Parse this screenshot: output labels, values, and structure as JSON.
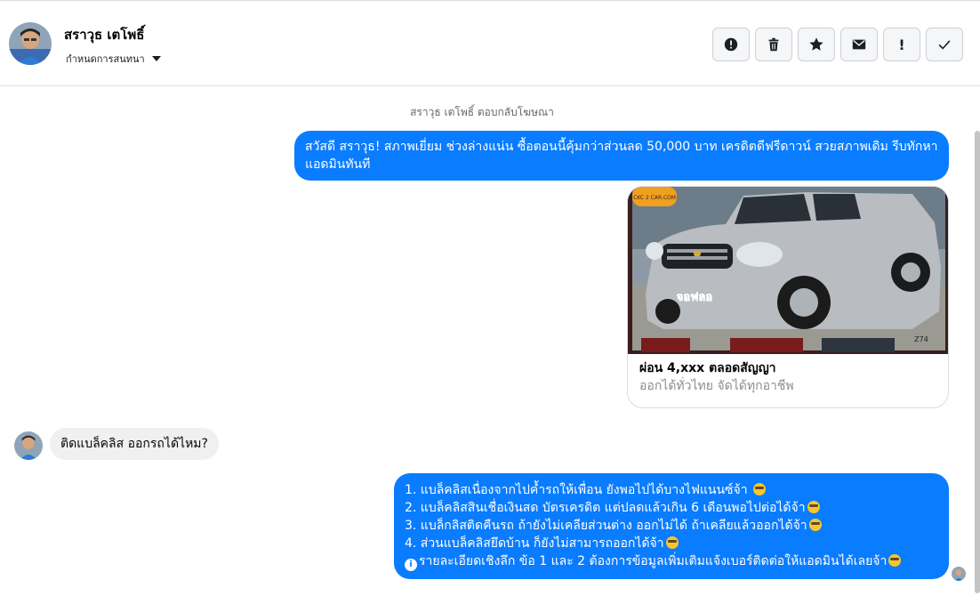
{
  "header": {
    "contact_name": "สราวุธ เตโพธิ์",
    "assign_label": "กำหนดการสนทนา",
    "actions": [
      {
        "icon": "alert-circle-icon",
        "label": ""
      },
      {
        "icon": "trash-icon",
        "label": ""
      },
      {
        "icon": "star-icon",
        "label": ""
      },
      {
        "icon": "envelope-icon",
        "label": ""
      },
      {
        "icon": "exclamation-icon",
        "label": "!"
      },
      {
        "icon": "checkmark-icon",
        "label": ""
      }
    ]
  },
  "thread": {
    "system_note": "สราวุธ เตโพธิ์ ตอบกลับโฆษณา",
    "outgoing_1": "สวัสดี สราวุธ!  สภาพเยี่ยม ช่วงล่างแน่น  ซื้อตอนนี้คุ้มกว่าส่วนลด 50,000 บาท เครดิตดีฟรีดาวน์  สวยสภาพเดิม รีบทักหาแอดมินทันที",
    "ad_card": {
      "image_badge": "CKC 2 CAR.COM",
      "image_sticker": "จอฟลอ",
      "image_tag": "Z74",
      "title": "ผ่อน 4,xxx ตลอดสัญญา",
      "subtitle": "ออกได้ทั่วไทย จัดได้ทุกอาชีพ"
    },
    "incoming_1": "ติดแบล็คลิส ออกรถได้ไหม?",
    "outgoing_2": [
      "1. แบล็คลิสเนื่องจากไปค้ำรถให้เพื่อน ยังพอไปได้บางไฟแนนซ์จ้า",
      "2. แบล็คลิสสินเชื่อเงินสด บัตรเครดิต แต่ปลดแล้วเกิน 6 เดือนพอไปต่อได้จ้า",
      "3. แบล็กลิสติดคืนรถ ถ้ายังไม่เคลียส่วนต่าง ออกไม่ได้ ถ้าเคลียแล้วออกได้จ้า",
      "4. ส่วนแบล็คลิสยึดบ้าน ก็ยังไม่สามารถออกได้จ้า",
      "รายละเอียดเชิงลึก ข้อ 1 และ 2 ต้องการข้อมูลเพิ่มเติมแจ้งเบอร์ติดต่อให้แอดมินได้เลยจ้า"
    ]
  },
  "colors": {
    "outgoing_bubble": "#0a7cff",
    "incoming_bubble": "#f0f0f0",
    "header_border": "#dadde1"
  }
}
